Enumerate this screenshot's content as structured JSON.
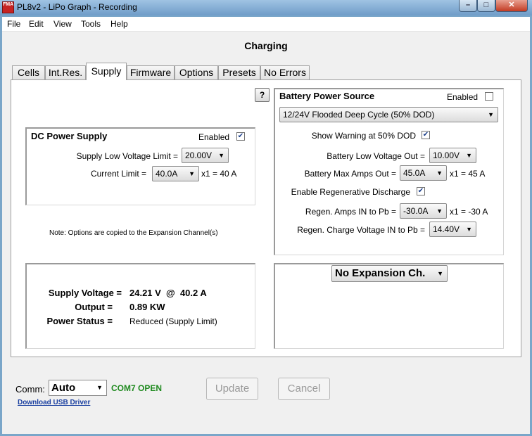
{
  "window": {
    "app_icon_text": "FMA",
    "title": "PL8v2 - LiPo Graph - Recording",
    "minimize": "–",
    "maximize": "□",
    "close": "✕"
  },
  "menu": {
    "items": [
      "File",
      "Edit",
      "View",
      "Tools",
      "Help"
    ]
  },
  "heading": "Charging",
  "tabs": [
    "Cells",
    "Int.Res.",
    "Supply",
    "Firmware",
    "Options",
    "Presets",
    "No Errors"
  ],
  "active_tab": "Supply",
  "help_button": "?",
  "dc_supply": {
    "title": "DC Power Supply",
    "enabled_label": "Enabled",
    "enabled": true,
    "low_voltage_label": "Supply Low Voltage Limit =",
    "low_voltage_value": "20.00V",
    "current_limit_label": "Current Limit =",
    "current_limit_value": "40.0A",
    "current_limit_suffix": "x1 = 40 A"
  },
  "note": "Note:  Options are copied to the Expansion Channel(s)",
  "battery": {
    "title": "Battery Power Source",
    "enabled_label": "Enabled",
    "enabled": false,
    "type_value": "12/24V Flooded Deep Cycle (50% DOD)",
    "warning_label": "Show Warning at 50% DOD",
    "warning_checked": true,
    "low_voltage_label": "Battery Low Voltage Out =",
    "low_voltage_value": "10.00V",
    "max_amps_label": "Battery Max Amps Out =",
    "max_amps_value": "45.0A",
    "max_amps_suffix": "x1 = 45 A",
    "regen_label": "Enable Regenerative Discharge",
    "regen_checked": true,
    "regen_amps_label": "Regen. Amps IN to Pb =",
    "regen_amps_value": "-30.0A",
    "regen_amps_suffix": "x1 = -30 A",
    "regen_voltage_label": "Regen. Charge Voltage IN to Pb =",
    "regen_voltage_value": "14.40V"
  },
  "status": {
    "supply_voltage_label": "Supply Voltage =",
    "supply_voltage_value": "24.21 V  @  40.2 A",
    "output_label": "Output =",
    "output_value": "0.89 KW",
    "power_status_label": "Power Status =",
    "power_status_value": "Reduced (Supply Limit)"
  },
  "expansion_value": "No Expansion Ch.",
  "footer": {
    "comm_label": "Comm:",
    "comm_value": "Auto",
    "com_status": "COM7 OPEN",
    "download_link": "Download USB Driver",
    "update_label": "Update",
    "cancel_label": "Cancel"
  },
  "colors": {
    "com_status": "#1f8a1f",
    "link": "#1a3fa0",
    "titlebar": "#7aa6c9",
    "close_button": "#c23a22"
  }
}
